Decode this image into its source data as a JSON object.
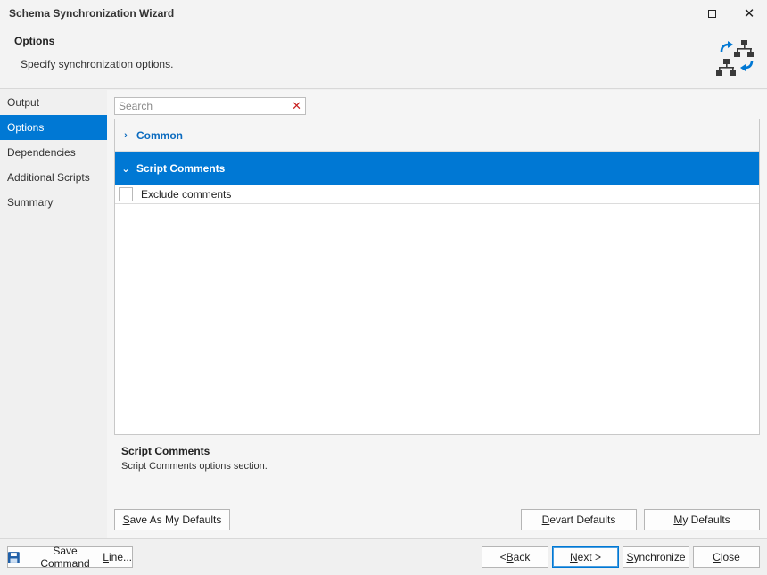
{
  "window": {
    "title": "Schema Synchronization Wizard"
  },
  "header": {
    "title": "Options",
    "description": "Specify synchronization options.",
    "icon": "schema-sync-icon"
  },
  "sidebar": {
    "items": [
      {
        "label": "Output",
        "active": false
      },
      {
        "label": "Options",
        "active": true
      },
      {
        "label": "Dependencies",
        "active": false
      },
      {
        "label": "Additional Scripts",
        "active": false
      },
      {
        "label": "Summary",
        "active": false
      }
    ]
  },
  "search": {
    "placeholder": "Search",
    "value": ""
  },
  "options": {
    "groups": [
      {
        "label": "Common",
        "expanded": false
      },
      {
        "label": "Script Comments",
        "expanded": true,
        "selected": true
      }
    ],
    "items": [
      {
        "label": "Exclude comments",
        "checked": false
      }
    ]
  },
  "description": {
    "title": "Script Comments",
    "text": "Script Comments options section."
  },
  "buttons": {
    "save_defaults": {
      "pre": "",
      "u": "S",
      "post": "ave As My Defaults"
    },
    "devart_defaults": {
      "pre": "",
      "u": "D",
      "post": "evart Defaults"
    },
    "my_defaults": {
      "pre": "",
      "u": "M",
      "post": "y Defaults"
    },
    "save_command_line": {
      "pre": "Save Command ",
      "u": "L",
      "post": "ine..."
    },
    "back": {
      "pre": "< ",
      "u": "B",
      "post": "ack"
    },
    "next": {
      "pre": "",
      "u": "N",
      "post": "ext >"
    },
    "synchronize": {
      "pre": "",
      "u": "S",
      "post": "ynchronize"
    },
    "close": {
      "pre": "",
      "u": "C",
      "post": "lose"
    }
  },
  "colors": {
    "accent": "#0078d4",
    "group_text": "#0b6bbf",
    "icon_dark": "#3a3a3a"
  }
}
